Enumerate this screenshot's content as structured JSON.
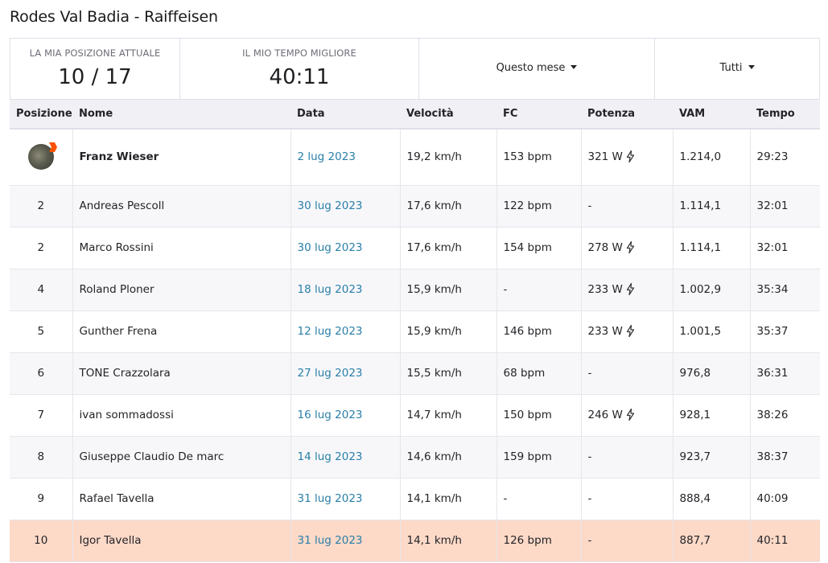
{
  "page_title": "Rodes Val Badia - Raiffeisen",
  "stats": {
    "position_label": "LA MIA POSIZIONE ATTUALE",
    "position_value": "10 / 17",
    "best_time_label": "IL MIO TEMPO MIGLIORE",
    "best_time_value": "40:11",
    "filter_period": "Questo mese",
    "filter_group": "Tutti"
  },
  "table": {
    "headers": {
      "position": "Posizione",
      "name": "Nome",
      "date": "Data",
      "speed": "Velocità",
      "hr": "FC",
      "power": "Potenza",
      "vam": "VAM",
      "time": "Tempo"
    },
    "rows": [
      {
        "rank": "",
        "name": "Franz Wieser",
        "date": "2 lug 2023",
        "speed": "19,2 km/h",
        "hr": "153 bpm",
        "power": "321 W",
        "vam": "1.214,0",
        "time": "29:23"
      },
      {
        "rank": "2",
        "name": "Andreas Pescoll",
        "date": "30 lug 2023",
        "speed": "17,6 km/h",
        "hr": "122 bpm",
        "power": "-",
        "vam": "1.114,1",
        "time": "32:01"
      },
      {
        "rank": "2",
        "name": "Marco Rossini",
        "date": "30 lug 2023",
        "speed": "17,6 km/h",
        "hr": "154 bpm",
        "power": "278 W",
        "vam": "1.114,1",
        "time": "32:01"
      },
      {
        "rank": "4",
        "name": "Roland Ploner",
        "date": "18 lug 2023",
        "speed": "15,9 km/h",
        "hr": "-",
        "power": "233 W",
        "vam": "1.002,9",
        "time": "35:34"
      },
      {
        "rank": "5",
        "name": "Gunther Frena",
        "date": "12 lug 2023",
        "speed": "15,9 km/h",
        "hr": "146 bpm",
        "power": "233 W",
        "vam": "1.001,5",
        "time": "35:37"
      },
      {
        "rank": "6",
        "name": "TONE Crazzolara",
        "date": "27 lug 2023",
        "speed": "15,5 km/h",
        "hr": "68 bpm",
        "power": "-",
        "vam": "976,8",
        "time": "36:31"
      },
      {
        "rank": "7",
        "name": "ivan sommadossi",
        "date": "16 lug 2023",
        "speed": "14,7 km/h",
        "hr": "150 bpm",
        "power": "246 W",
        "vam": "928,1",
        "time": "38:26"
      },
      {
        "rank": "8",
        "name": "Giuseppe Claudio De marc",
        "date": "14 lug 2023",
        "speed": "14,6 km/h",
        "hr": "159 bpm",
        "power": "-",
        "vam": "923,7",
        "time": "38:37"
      },
      {
        "rank": "9",
        "name": "Rafael Tavella",
        "date": "31 lug 2023",
        "speed": "14,1 km/h",
        "hr": "-",
        "power": "-",
        "vam": "888,4",
        "time": "40:09"
      },
      {
        "rank": "10",
        "name": "Igor Tavella",
        "date": "31 lug 2023",
        "speed": "14,1 km/h",
        "hr": "126 bpm",
        "power": "-",
        "vam": "887,7",
        "time": "40:11"
      }
    ],
    "power_icon": "lightning-bolt-icon",
    "leader_icon": "crown-icon",
    "highlight_color": "#fdd9c8",
    "link_color": "#2a7fa8"
  }
}
